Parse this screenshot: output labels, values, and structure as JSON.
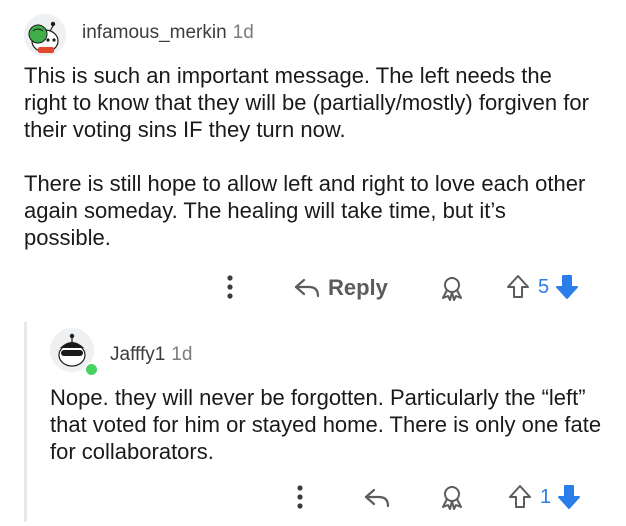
{
  "comment": {
    "username": "infamous_merkin",
    "age": "1d",
    "paragraphs": [
      "This is such an important message.  The left needs the right to know that they will be (partially/mostly) forgiven for their voting sins IF they turn now.",
      "There is still hope to allow left and right to love each other again someday. The healing will take time, but it’s possible."
    ],
    "actions": {
      "reply_label": "Reply",
      "score": "5"
    }
  },
  "reply": {
    "username": "Jafffy1",
    "age": "1d",
    "paragraphs": [
      "Nope. they will never be forgotten. Particularly the “left” that voted for him or stayed home. There is only one fate for collaborators."
    ],
    "actions": {
      "score": "1"
    },
    "online_status_color": "#46d160"
  },
  "colors": {
    "upvote_outline": "#5c5c5c",
    "downvote_active": "#2b7de9",
    "score_text": "#2b7de9"
  },
  "icons": [
    "more-options-icon",
    "reply-arrow-icon",
    "award-icon",
    "upvote-icon",
    "downvote-icon"
  ]
}
